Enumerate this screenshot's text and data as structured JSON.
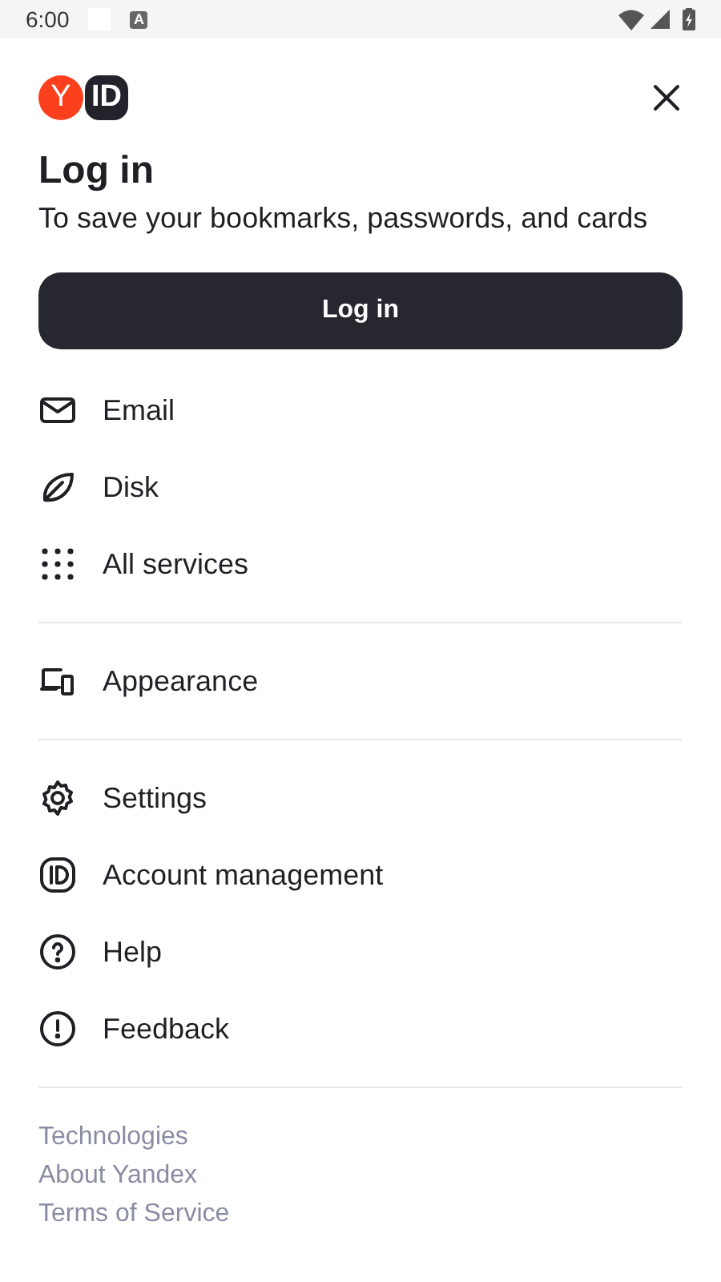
{
  "status_bar": {
    "time": "6:00",
    "notification_glyph": "A"
  },
  "logo": {
    "mark": "Y",
    "badge": "ID"
  },
  "title": "Log in",
  "subtitle": "To save your bookmarks, passwords, and cards",
  "login_button": "Log in",
  "menu_groups": [
    [
      "Email",
      "Disk",
      "All services"
    ],
    [
      "Appearance"
    ],
    [
      "Settings",
      "Account management",
      "Help",
      "Feedback"
    ]
  ],
  "footer_links": [
    "Technologies",
    "About Yandex",
    "Terms of Service"
  ]
}
